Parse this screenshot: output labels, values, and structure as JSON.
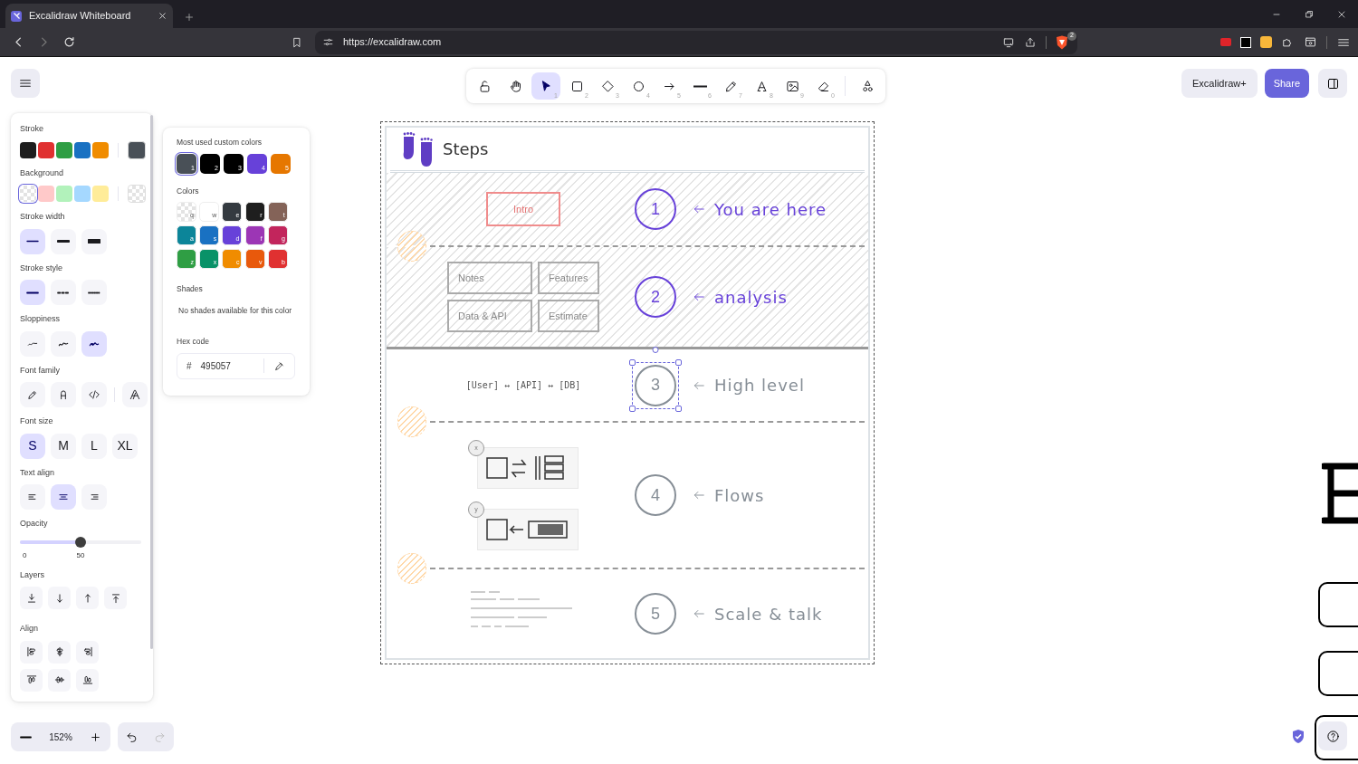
{
  "browser": {
    "tab_title": "Excalidraw Whiteboard",
    "url": "https://excalidraw.com",
    "shields_count": "2"
  },
  "toolbar": {
    "tools": [
      {
        "selected": false
      },
      {
        "selected": false
      },
      {
        "key": "1",
        "selected": true
      },
      {
        "key": "2",
        "selected": false
      },
      {
        "key": "3",
        "selected": false
      },
      {
        "key": "4",
        "selected": false
      },
      {
        "key": "5",
        "selected": false
      },
      {
        "key": "6",
        "selected": false
      },
      {
        "key": "7",
        "selected": false
      },
      {
        "key": "8",
        "selected": false
      },
      {
        "key": "9",
        "selected": false
      },
      {
        "key": "0",
        "selected": false
      },
      {
        "selected": false
      }
    ]
  },
  "header_buttons": {
    "plus": "Excalidraw+",
    "share": "Share"
  },
  "properties": [
    {
      "kind": "swatches",
      "label": "Stroke",
      "swatches": [
        {
          "color": "#1e1e1e",
          "selected": false
        },
        {
          "color": "#e03131",
          "selected": false
        },
        {
          "color": "#2f9e44",
          "selected": false
        },
        {
          "color": "#1971c2",
          "selected": false
        },
        {
          "color": "#f08c00",
          "selected": false
        }
      ],
      "current": {
        "color": "#495057"
      }
    },
    {
      "kind": "swatches",
      "label": "Background",
      "swatches": [
        {
          "transparent": true,
          "selected": true
        },
        {
          "color": "#ffc9c9",
          "selected": false
        },
        {
          "color": "#b2f2bb",
          "selected": false
        },
        {
          "color": "#a5d8ff",
          "selected": false
        },
        {
          "color": "#ffec99",
          "selected": false
        }
      ],
      "current": {
        "transparent": true
      }
    },
    {
      "kind": "options",
      "label": "Stroke width",
      "options": [
        {
          "selected": true
        },
        {
          "selected": false
        },
        {
          "selected": false
        }
      ]
    },
    {
      "kind": "options",
      "label": "Stroke style",
      "options": [
        {
          "selected": true
        },
        {
          "selected": false
        },
        {
          "selected": false
        }
      ]
    },
    {
      "kind": "options",
      "label": "Sloppiness",
      "options": [
        {
          "selected": false
        },
        {
          "selected": false
        },
        {
          "selected": true
        }
      ]
    },
    {
      "kind": "options",
      "label": "Font family",
      "options": [
        {
          "selected": false
        },
        {
          "selected": false
        },
        {
          "selected": false
        },
        {
          "selected": false
        }
      ]
    },
    {
      "kind": "options",
      "label": "Font size",
      "options": [
        {
          "text": "S",
          "selected": true
        },
        {
          "text": "M",
          "selected": false
        },
        {
          "text": "L",
          "selected": false
        },
        {
          "text": "XL",
          "selected": false
        }
      ]
    },
    {
      "kind": "options",
      "label": "Text align",
      "options": [
        {
          "selected": false
        },
        {
          "selected": true
        },
        {
          "selected": false
        }
      ]
    },
    {
      "kind": "slider",
      "label": "Opacity",
      "level": 0.5,
      "min": "0",
      "value": "50"
    },
    {
      "kind": "actions",
      "label": "Layers"
    },
    {
      "kind": "actions",
      "label": "Align"
    }
  ],
  "color_picker": {
    "custom_label": "Most used custom colors",
    "custom": [
      {
        "color": "#495057",
        "key": "1",
        "selected": true
      },
      {
        "color": "#000000",
        "key": "2",
        "selected": false
      },
      {
        "color": "#000000",
        "key": "3",
        "selected": false
      },
      {
        "color": "#6741d9",
        "key": "4",
        "selected": false
      },
      {
        "color": "#e67700",
        "key": "5",
        "selected": false
      }
    ],
    "colors_label": "Colors",
    "colors": [
      {
        "transparent": true,
        "key": "q"
      },
      {
        "color": "#ffffff",
        "key": "w"
      },
      {
        "color": "#343a40",
        "key": "e"
      },
      {
        "color": "#1e1e1e",
        "key": "r"
      },
      {
        "color": "#846358",
        "key": "t"
      },
      {
        "color": "#0c8599",
        "key": "a"
      },
      {
        "color": "#1971c2",
        "key": "s"
      },
      {
        "color": "#6741d9",
        "key": "d"
      },
      {
        "color": "#9c36b5",
        "key": "f"
      },
      {
        "color": "#c2255c",
        "key": "g"
      },
      {
        "color": "#2f9e44",
        "key": "z"
      },
      {
        "color": "#099268",
        "key": "x"
      },
      {
        "color": "#f08c00",
        "key": "c"
      },
      {
        "color": "#e8590c",
        "key": "v"
      },
      {
        "color": "#e03131",
        "key": "b"
      }
    ],
    "shades_label": "Shades",
    "shades_text": "No shades available for this color",
    "hex_label": "Hex code",
    "hex_prefix": "#",
    "hex": "495057"
  },
  "canvas": {
    "title": "Steps",
    "steps": [
      {
        "number": "1",
        "caption": "You are here",
        "color": "#6741d9",
        "shaded": true,
        "selected": false,
        "divider": {
          "kind": "dashed"
        },
        "content": {
          "kind": "box",
          "text": "Intro"
        }
      },
      {
        "number": "2",
        "caption": "analysis",
        "color": "#6741d9",
        "shaded": true,
        "selected": false,
        "divider": {
          "kind": "solid"
        },
        "hatched_dot": true,
        "content": {
          "kind": "grid",
          "cells": [
            "Notes",
            "Features",
            "Data & API",
            "Estimate"
          ]
        }
      },
      {
        "number": "3",
        "caption": "High level",
        "color": "#868e96",
        "shaded": false,
        "selected": true,
        "divider": {
          "kind": "dashed"
        },
        "content": {
          "kind": "text",
          "text": "[User] ↔ [API] ↔ [DB]"
        }
      },
      {
        "number": "4",
        "caption": "Flows",
        "color": "#868e96",
        "shaded": false,
        "selected": false,
        "divider": {
          "kind": "dashed"
        },
        "hatched_dot": true,
        "content": {
          "kind": "flows",
          "badges": [
            "x",
            "y"
          ]
        }
      },
      {
        "number": "5",
        "caption": "Scale & talk",
        "color": "#868e96",
        "shaded": false,
        "selected": false,
        "hatched_dot": true,
        "content": {
          "kind": "lines"
        }
      }
    ]
  },
  "zoom": "152%"
}
